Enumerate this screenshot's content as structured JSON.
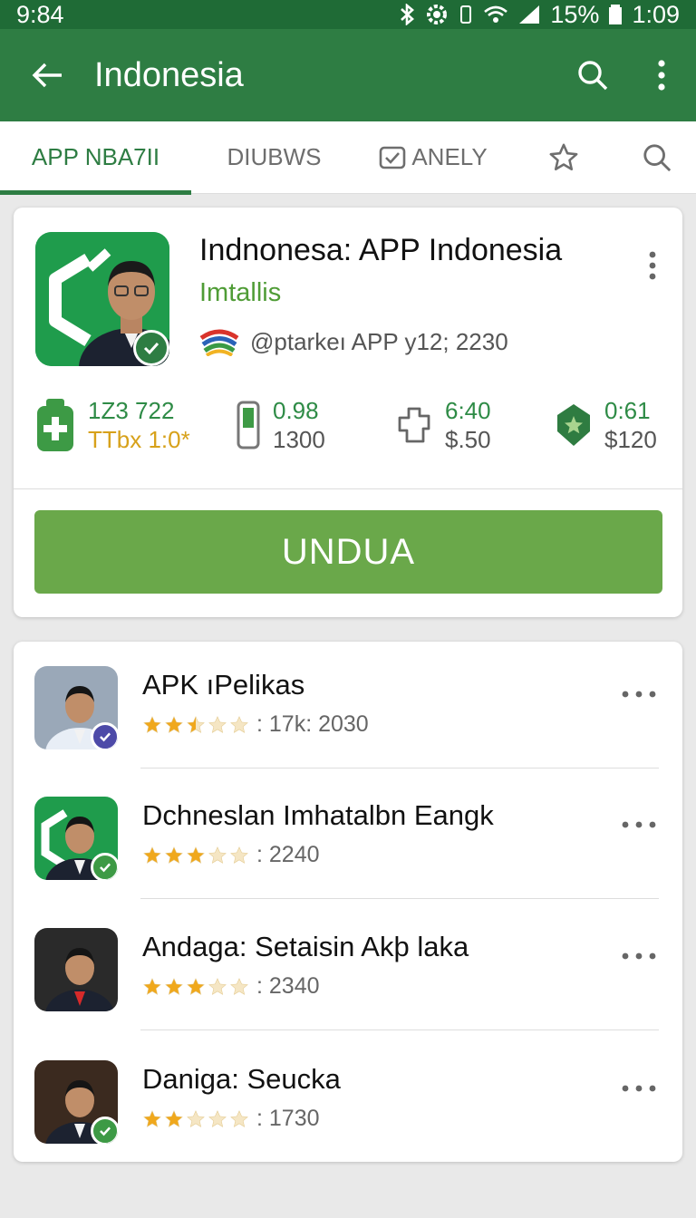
{
  "status_bar": {
    "time": "9:84",
    "battery": "15%",
    "clock": "1:09"
  },
  "app_bar": {
    "title": "Indonesia"
  },
  "tabs": [
    {
      "label": "APP NBA7II",
      "active": true
    },
    {
      "label": "DIUBWS",
      "active": false
    },
    {
      "label": "ANELY",
      "active": false
    }
  ],
  "hero": {
    "title": "Indnonesa: APP Indonesia",
    "subtitle": "Imtallis",
    "developer": "@ptarkeı APP y12; 2230",
    "stats": [
      {
        "line1": "1Z3 722",
        "line2": "TTbx 1:0*",
        "icon": "health-plus-icon"
      },
      {
        "line1": "0.98",
        "line2": "1300",
        "icon": "phone-battery-icon"
      },
      {
        "line1": "6:40",
        "line2": "$.50",
        "icon": "puzzle-icon"
      },
      {
        "line1": "0:61",
        "line2": "$120",
        "icon": "star-shield-icon"
      }
    ],
    "install_label": "UNDUA"
  },
  "list": [
    {
      "name": "APK ıPelikas",
      "rating_value": 2.5,
      "rating_text": ": 17k: 2030",
      "badge": "purple",
      "bg": "#9aa8b8"
    },
    {
      "name": "Dchneslan Imhatalbn Eangk",
      "rating_value": 3,
      "rating_text": ": 2240",
      "badge": "green",
      "bg": "#1f9c4c"
    },
    {
      "name": "Andaga: Setaisin Akþ laka",
      "rating_value": 3,
      "rating_text": ": 2340",
      "badge": "none",
      "bg": "#2a2a2a"
    },
    {
      "name": "Daniga: Seucka",
      "rating_value": 2,
      "rating_text": ": 1730",
      "badge": "green",
      "bg": "#3b2a1f"
    }
  ],
  "colors": {
    "primary": "#2e7d43",
    "primary_dark": "#1f6b36",
    "install_button": "#6aa84a",
    "star": "#f0a81c"
  }
}
